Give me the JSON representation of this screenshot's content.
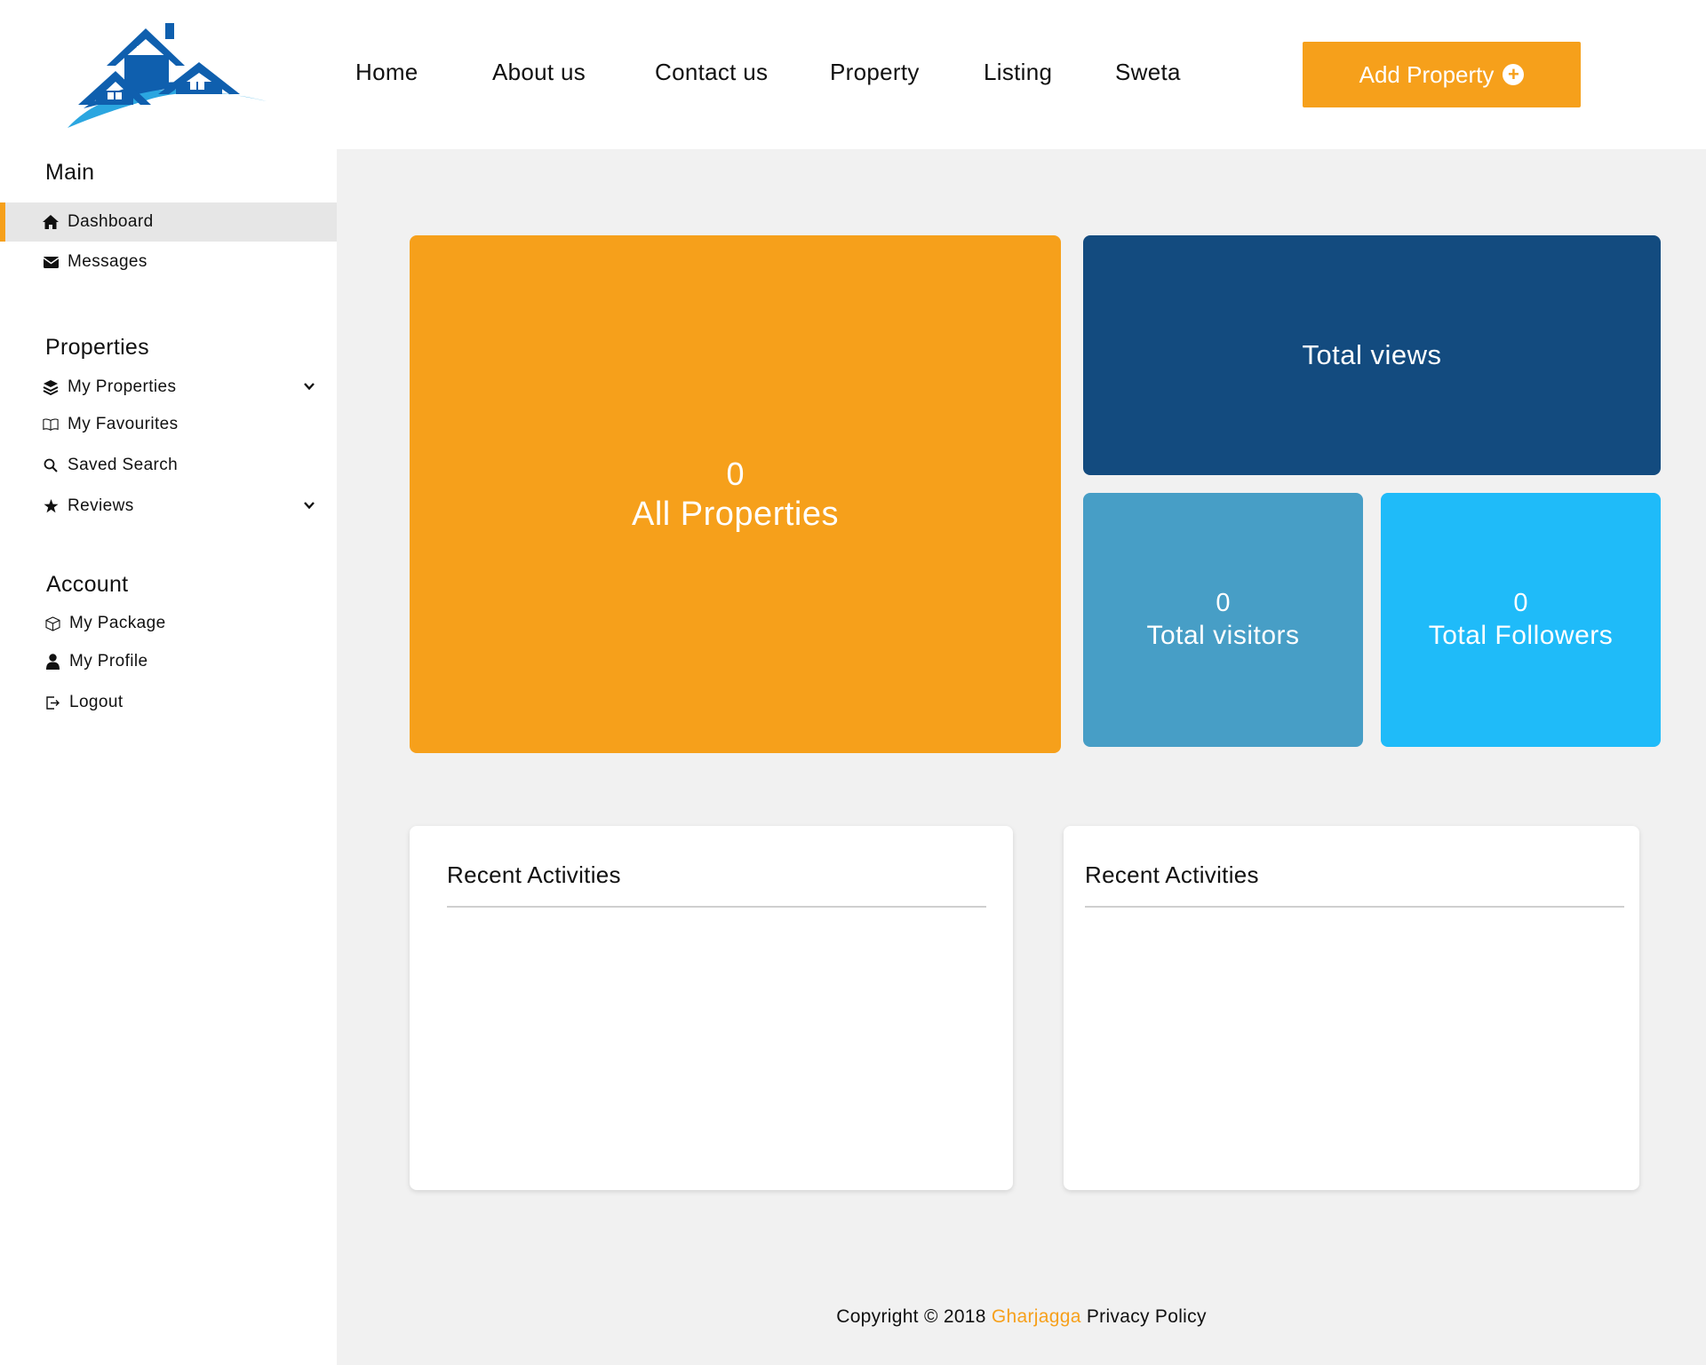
{
  "header": {
    "nav": [
      {
        "label": "Home",
        "name": "nav-home"
      },
      {
        "label": "About us",
        "name": "nav-about-us"
      },
      {
        "label": "Contact us",
        "name": "nav-contact-us"
      },
      {
        "label": "Property",
        "name": "nav-property"
      },
      {
        "label": "Listing",
        "name": "nav-listing"
      },
      {
        "label": "Sweta",
        "name": "nav-user-sweta"
      }
    ],
    "add_property_label": "Add Property"
  },
  "sidebar": {
    "main_heading": "Main",
    "main_items": [
      {
        "label": "Dashboard",
        "icon": "home-icon",
        "active": true
      },
      {
        "label": "Messages",
        "icon": "envelope-icon"
      }
    ],
    "properties_heading": "Properties",
    "properties_items": [
      {
        "label": "My Properties",
        "icon": "layers-icon",
        "expandable": true
      },
      {
        "label": "My Favourites",
        "icon": "open-book-icon"
      },
      {
        "label": "Saved Search",
        "icon": "search-icon"
      },
      {
        "label": "Reviews",
        "icon": "star-icon",
        "expandable": true
      }
    ],
    "account_heading": "Account",
    "account_items": [
      {
        "label": "My Package",
        "icon": "package-icon"
      },
      {
        "label": "My Profile",
        "icon": "user-icon"
      },
      {
        "label": "Logout",
        "icon": "logout-icon"
      }
    ]
  },
  "stats": {
    "all_properties": {
      "value": "0",
      "label": "All Properties"
    },
    "total_views": {
      "label": "Total views"
    },
    "total_visitors": {
      "value": "0",
      "label": "Total visitors"
    },
    "total_followers": {
      "value": "0",
      "label": "Total Followers"
    }
  },
  "panels": [
    {
      "title": "Recent Activities"
    },
    {
      "title": "Recent Activities"
    }
  ],
  "footer": {
    "copyright": "Copyright © 2018",
    "brand": "Gharjagga",
    "privacy": "Privacy Policy"
  },
  "colors": {
    "accent": "#f6a01b",
    "navy": "#134b7f",
    "steel": "#479ec6",
    "sky": "#1fbbf9",
    "main_bg": "#f1f1f1"
  }
}
